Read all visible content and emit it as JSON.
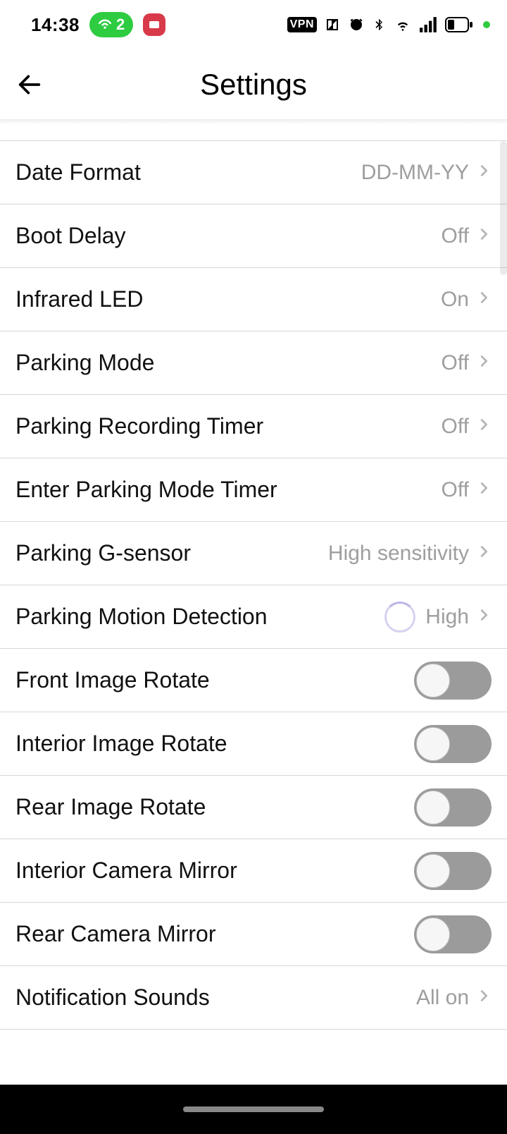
{
  "status": {
    "time": "14:38",
    "hotspot_count": "2",
    "vpn": "VPN"
  },
  "header": {
    "title": "Settings"
  },
  "rows": [
    {
      "key": "date_format",
      "label": "Date Format",
      "value": "DD-MM-YY",
      "type": "nav"
    },
    {
      "key": "boot_delay",
      "label": "Boot Delay",
      "value": "Off",
      "type": "nav"
    },
    {
      "key": "infrared_led",
      "label": "Infrared LED",
      "value": "On",
      "type": "nav"
    },
    {
      "key": "parking_mode",
      "label": "Parking Mode",
      "value": "Off",
      "type": "nav"
    },
    {
      "key": "parking_rec_timer",
      "label": "Parking Recording Timer",
      "value": "Off",
      "type": "nav"
    },
    {
      "key": "enter_parking",
      "label": "Enter Parking Mode Timer",
      "value": "Off",
      "type": "nav"
    },
    {
      "key": "parking_gsensor",
      "label": "Parking G-sensor",
      "value": "High sensitivity",
      "type": "nav"
    },
    {
      "key": "parking_motion",
      "label": "Parking Motion Detection",
      "value": "High",
      "type": "nav",
      "spinner": true
    },
    {
      "key": "front_rotate",
      "label": "Front Image Rotate",
      "type": "toggle",
      "on": false
    },
    {
      "key": "interior_rotate",
      "label": "Interior Image Rotate",
      "type": "toggle",
      "on": false
    },
    {
      "key": "rear_rotate",
      "label": "Rear Image Rotate",
      "type": "toggle",
      "on": false
    },
    {
      "key": "interior_mirror",
      "label": "Interior Camera Mirror",
      "type": "toggle",
      "on": false
    },
    {
      "key": "rear_mirror",
      "label": "Rear Camera Mirror",
      "type": "toggle",
      "on": false
    },
    {
      "key": "notif_sounds",
      "label": "Notification Sounds",
      "value": "All on",
      "type": "nav"
    }
  ]
}
